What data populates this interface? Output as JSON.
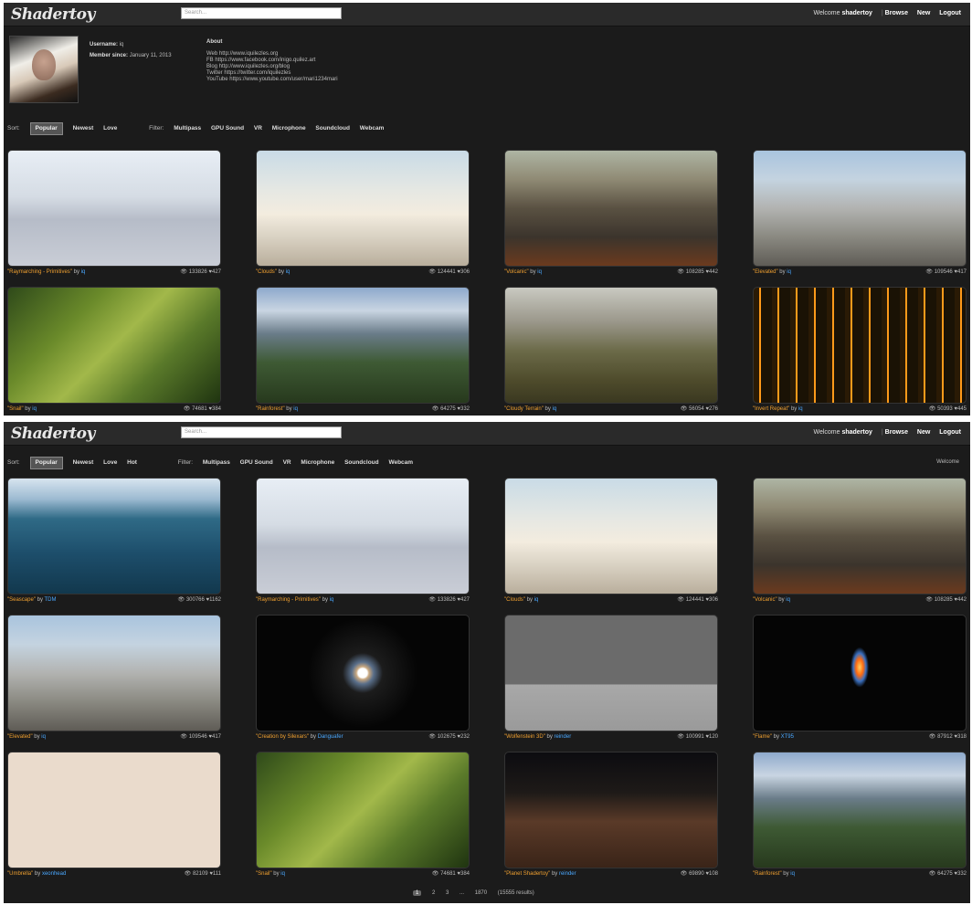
{
  "top": {
    "logo": "Shadertoy",
    "search_placeholder": "Search...",
    "nav": {
      "welcome": "Welcome",
      "user": "shadertoy",
      "sep": "|",
      "browse": "Browse",
      "new": "New",
      "logout": "Logout"
    },
    "profile": {
      "username_label": "Username:",
      "username": "iq",
      "member_label": "Member since:",
      "member_since": "January 11, 2013",
      "about_label": "About",
      "about_lines": [
        "Web http://www.iquilezles.org",
        "FB https://www.facebook.com/inigo.quilez.art",
        "Blog http://www.iquilezles.org/blog",
        "Twitter https://twitter.com/iquilezles",
        "YouTube https://www.youtube.com/user/mari1234mari"
      ]
    },
    "sort": {
      "label": "Sort:",
      "options": [
        "Popular",
        "Newest",
        "Love"
      ]
    },
    "filter": {
      "label": "Filter:",
      "options": [
        "Multipass",
        "GPU Sound",
        "VR",
        "Microphone",
        "Soundcloud",
        "Webcam"
      ]
    },
    "shaders": [
      {
        "name": "\"Raymarching - Primitives\"",
        "author": "iq",
        "views": "133826",
        "likes": "427",
        "icon": "raymarch"
      },
      {
        "name": "\"Clouds\"",
        "author": "iq",
        "views": "124441",
        "likes": "306",
        "icon": "clouds"
      },
      {
        "name": "\"Volcanic\"",
        "author": "iq",
        "views": "108285",
        "likes": "442",
        "icon": "volcanic"
      },
      {
        "name": "\"Elevated\"",
        "author": "iq",
        "views": "109546",
        "likes": "417",
        "icon": "mountain"
      },
      {
        "name": "\"Snail\"",
        "author": "iq",
        "views": "74681",
        "likes": "384",
        "icon": "snail"
      },
      {
        "name": "\"Rainforest\"",
        "author": "iq",
        "views": "64275",
        "likes": "332",
        "icon": "rainforest"
      },
      {
        "name": "\"Cloudy Terrain\"",
        "author": "iq",
        "views": "56054",
        "likes": "276",
        "icon": "cloudy"
      },
      {
        "name": "\"Invert Repeat\"",
        "author": "iq",
        "views": "50393",
        "likes": "445",
        "icon": "circuit"
      }
    ]
  },
  "bottom": {
    "logo": "Shadertoy",
    "search_placeholder": "Search...",
    "nav": {
      "welcome": "Welcome",
      "user": "shadertoy",
      "sep": "|",
      "browse": "Browse",
      "new": "New",
      "logout": "Logout"
    },
    "sort": {
      "label": "Sort:",
      "options": [
        "Popular",
        "Newest",
        "Love",
        "Hot"
      ]
    },
    "filter": {
      "label": "Filter:",
      "options": [
        "Multipass",
        "GPU Sound",
        "VR",
        "Microphone",
        "Soundcloud",
        "Webcam"
      ]
    },
    "right_link": "Welcome",
    "shaders": [
      {
        "name": "\"Seascape\"",
        "author": "TDM",
        "views": "300766",
        "likes": "1162",
        "icon": "seascape"
      },
      {
        "name": "\"Raymarching - Primitives\"",
        "author": "iq",
        "views": "133826",
        "likes": "427",
        "icon": "raymarch"
      },
      {
        "name": "\"Clouds\"",
        "author": "iq",
        "views": "124441",
        "likes": "306",
        "icon": "clouds"
      },
      {
        "name": "\"Volcanic\"",
        "author": "iq",
        "views": "108285",
        "likes": "442",
        "icon": "volcanic"
      },
      {
        "name": "\"Elevated\"",
        "author": "iq",
        "views": "109546",
        "likes": "417",
        "icon": "mountain"
      },
      {
        "name": "\"Creation by Silexars\"",
        "author": "Danguafer",
        "views": "102675",
        "likes": "232",
        "icon": "reflection"
      },
      {
        "name": "\"Wolfenstein 3D\"",
        "author": "reinder",
        "views": "100991",
        "likes": "120",
        "icon": "wolf"
      },
      {
        "name": "\"Flame\"",
        "author": "XT95",
        "views": "87912",
        "likes": "318",
        "icon": "flame"
      },
      {
        "name": "\"Umbrella\"",
        "author": "xeonhead",
        "views": "82109",
        "likes": "111",
        "icon": "umbrella"
      },
      {
        "name": "\"Snail\"",
        "author": "iq",
        "views": "74681",
        "likes": "384",
        "icon": "snail"
      },
      {
        "name": "\"Planet Shadertoy\"",
        "author": "reinder",
        "views": "69890",
        "likes": "108",
        "icon": "planet"
      },
      {
        "name": "\"Rainforest\"",
        "author": "iq",
        "views": "64275",
        "likes": "332",
        "icon": "rainforest"
      }
    ],
    "pager": {
      "pages": [
        "1",
        "2",
        "3",
        "...",
        "1870"
      ],
      "results": "(15555 results)"
    }
  },
  "colors": {
    "shader_name": "#f0a030",
    "author": "#4aa8ff",
    "background": "#1b1b1b"
  }
}
